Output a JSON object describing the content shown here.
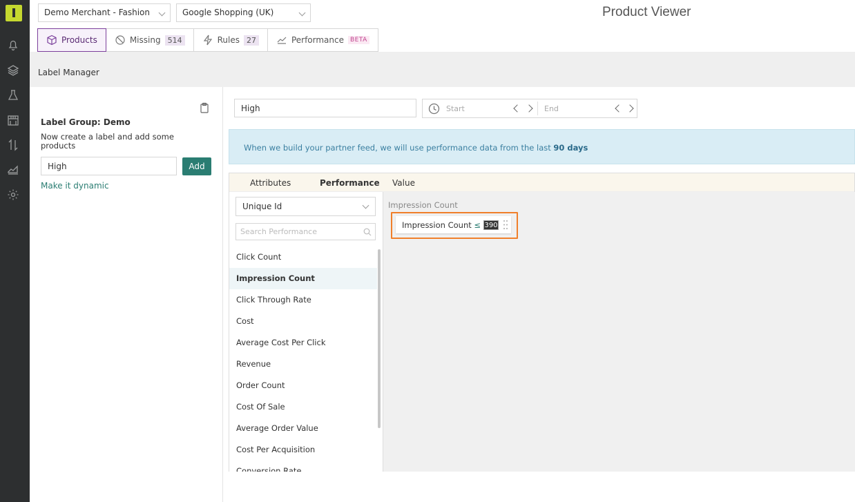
{
  "header": {
    "merchant_select": "Demo Merchant - Fashion",
    "channel_select": "Google Shopping (UK)",
    "app_title": "Product Viewer"
  },
  "tabs": [
    {
      "label": "Products",
      "icon": "box-icon"
    },
    {
      "label": "Missing",
      "count": "514",
      "icon": "ban-icon"
    },
    {
      "label": "Rules",
      "count": "27",
      "icon": "bolt-icon"
    },
    {
      "label": "Performance",
      "badge": "BETA",
      "icon": "chart-icon"
    }
  ],
  "rail_icons": [
    "bell-icon",
    "layers-icon",
    "flask-icon",
    "store-icon",
    "sort-arrows-icon",
    "area-chart-icon",
    "gear-icon"
  ],
  "label_manager": {
    "title": "Label Manager",
    "group_title": "Label Group: Demo",
    "help": "Now create a label and add some products",
    "input_value": "High",
    "add_label": "Add",
    "dynamic_link": "Make it dynamic"
  },
  "editor": {
    "name_value": "High",
    "date_start_placeholder": "Start",
    "date_end_placeholder": "End",
    "banner_text": "When we build your partner feed, we will use performance data from the last ",
    "banner_bold": "90 days",
    "builder_tabs": [
      "Attributes",
      "Performance",
      "Value"
    ],
    "uid_select": "Unique Id",
    "search_placeholder": "Search Performance",
    "metrics": [
      "Click Count",
      "Impression Count",
      "Click Through Rate",
      "Cost",
      "Average Cost Per Click",
      "Revenue",
      "Order Count",
      "Cost Of Sale",
      "Average Order Value",
      "Cost Per Acquisition",
      "Conversion Rate"
    ],
    "selected_metric": "Impression Count",
    "value_label": "Impression Count",
    "condition": {
      "field": "Impression Count",
      "operator": "≤ 3",
      "match_count": "390"
    }
  },
  "colors": {
    "accent_teal": "#2a7d72",
    "accent_purple": "#7b3f9b",
    "highlight_orange": "#f07f2a",
    "rail_bg": "#2d2f30",
    "logo": "#c5d82f"
  }
}
